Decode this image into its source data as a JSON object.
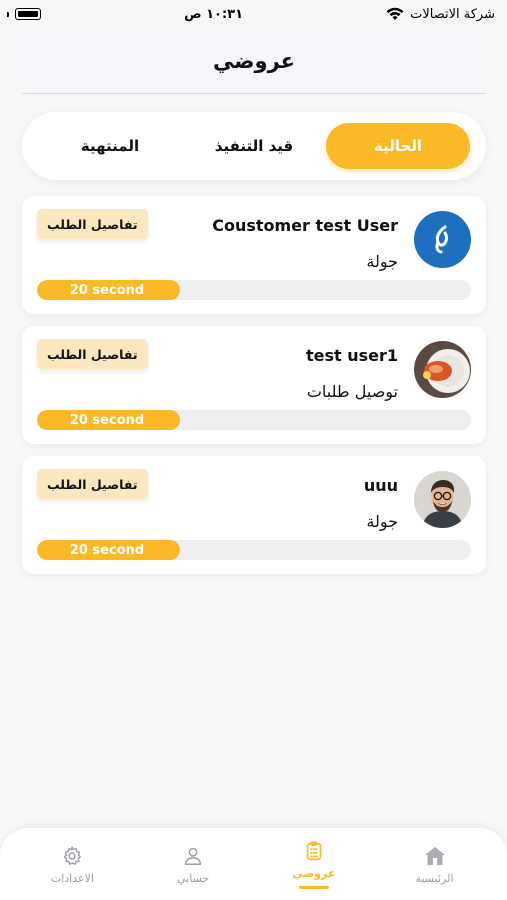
{
  "status_bar": {
    "carrier": "شركة الاتصالات",
    "time": "١٠:٣١ ص"
  },
  "header": {
    "title": "عروضي"
  },
  "tabs": [
    {
      "label": "الحالية",
      "active": true
    },
    {
      "label": "قيد التنفيذ",
      "active": false
    },
    {
      "label": "المنتهية",
      "active": false
    }
  ],
  "offers": [
    {
      "name": "Coustomer test User",
      "service": "جولة",
      "details_label": "تفاصيل الطلب",
      "timer_label": "20 second",
      "progress_percent": 33,
      "avatar": "logo-avatar"
    },
    {
      "name": "test user1",
      "service": "توصيل طلبات",
      "details_label": "تفاصيل الطلب",
      "timer_label": "20 second",
      "progress_percent": 33,
      "avatar": "food-photo-avatar"
    },
    {
      "name": "uuu",
      "service": "جولة",
      "details_label": "تفاصيل الطلب",
      "timer_label": "20 second",
      "progress_percent": 33,
      "avatar": "person-photo-avatar"
    }
  ],
  "bottom_nav": [
    {
      "label": "الاعدادات",
      "icon": "gear-icon",
      "active": false
    },
    {
      "label": "حسابي",
      "icon": "user-icon",
      "active": false
    },
    {
      "label": "عروضي",
      "icon": "clipboard-icon",
      "active": true
    },
    {
      "label": "الرئيسية",
      "icon": "home-icon",
      "active": false
    }
  ],
  "colors": {
    "accent": "#fbb928",
    "details_bg": "#fde7bf",
    "logo_blue": "#1f6fbf"
  }
}
